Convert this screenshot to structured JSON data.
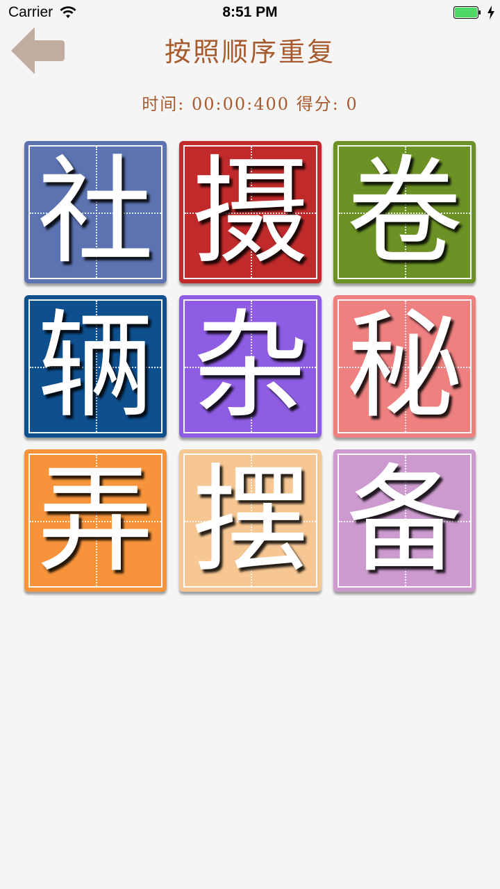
{
  "status_bar": {
    "carrier": "Carrier",
    "time": "8:51 PM",
    "battery_color": "#4cd964"
  },
  "header": {
    "back_icon": "left-arrow-icon",
    "back_color": "#c1ada0",
    "title": "按照顺序重复",
    "timer_label": "时间:",
    "timer_value": "00:00:400",
    "score_label": "得分:",
    "score_value": "0",
    "text_color": "#a75a2e"
  },
  "tiles": [
    {
      "char": "社",
      "color": "#5b73b0"
    },
    {
      "char": "摄",
      "color": "#c12a2a"
    },
    {
      "char": "卷",
      "color": "#6c9226"
    },
    {
      "char": "辆",
      "color": "#0e4f8e"
    },
    {
      "char": "杂",
      "color": "#8e5de3"
    },
    {
      "char": "秘",
      "color": "#ef8080"
    },
    {
      "char": "弄",
      "color": "#f7943b"
    },
    {
      "char": "摆",
      "color": "#f7c793"
    },
    {
      "char": "备",
      "color": "#cd9acf"
    }
  ]
}
